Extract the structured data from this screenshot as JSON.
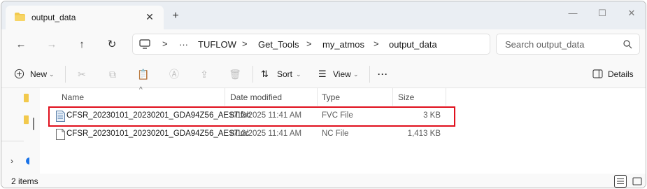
{
  "tab": {
    "title": "output_data",
    "close_glyph": "✕",
    "new_glyph": "+"
  },
  "window_controls": {
    "minimize": "—",
    "maximize": "☐",
    "close": "✕"
  },
  "nav": {
    "back": "←",
    "forward": "→",
    "up": "↑",
    "refresh": "↻"
  },
  "address": {
    "ellipsis": "···",
    "crumbs": [
      "TUFLOW",
      "Get_Tools",
      "my_atmos",
      "output_data"
    ],
    "sep": ">"
  },
  "search": {
    "placeholder": "Search output_data"
  },
  "toolbar": {
    "new_label": "New",
    "sort_label": "Sort",
    "view_label": "View",
    "more_label": "···",
    "details_label": "Details",
    "icons": [
      "cut-icon",
      "copy-icon",
      "paste-icon",
      "rename-icon",
      "share-icon",
      "delete-icon"
    ]
  },
  "columns": {
    "name": "Name",
    "date": "Date modified",
    "type": "Type",
    "size": "Size"
  },
  "files": [
    {
      "name": "CFSR_20230101_20230201_GDA94Z56_AEST.fvc",
      "date": "8/12/2025 11:41 AM",
      "type": "FVC File",
      "size": "3 KB",
      "icon": "fvc-file-icon"
    },
    {
      "name": "CFSR_20230101_20230201_GDA94Z56_AEST.nc",
      "date": "8/12/2025 11:41 AM",
      "type": "NC File",
      "size": "1,413 KB",
      "icon": "nc-file-icon"
    }
  ],
  "status": {
    "count": "2 items"
  },
  "colors": {
    "highlight": "#e0101d",
    "folder": "#f2c94c",
    "accent": "#1a73e8"
  }
}
